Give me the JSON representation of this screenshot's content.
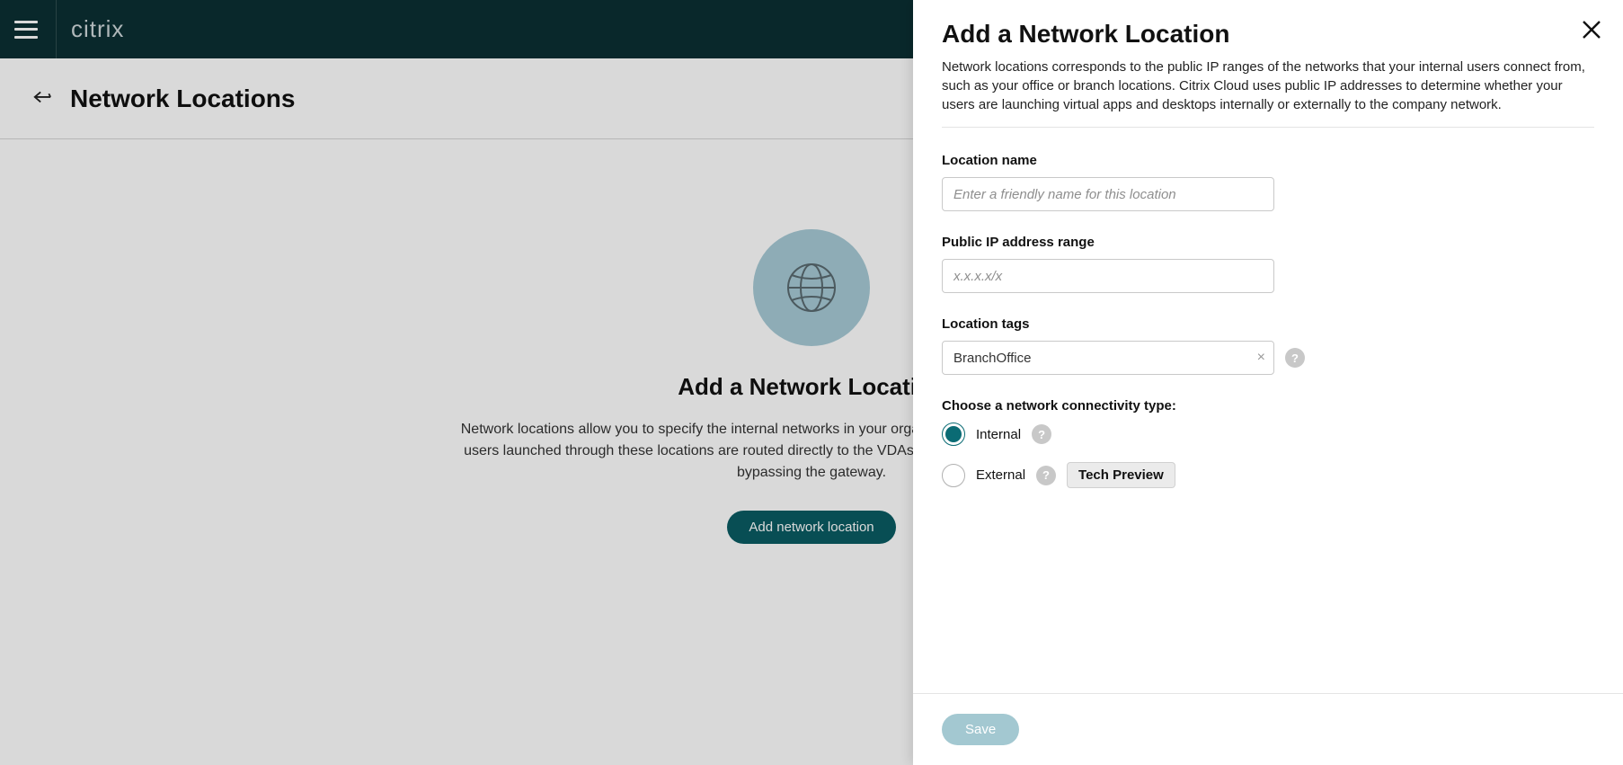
{
  "brand": "citrix",
  "page": {
    "title": "Network Locations"
  },
  "empty": {
    "heading": "Add a Network Location",
    "description": "Network locations allow you to specify the internal networks in your organization. Workspace connections from users launched through these locations are routed directly to the VDAs hosting the virtual apps and desktops, bypassing the gateway.",
    "add_button": "Add network location"
  },
  "panel": {
    "title": "Add a Network Location",
    "description": "Network locations corresponds to the public IP ranges of the networks that your internal users connect from, such as your office or branch locations. Citrix Cloud uses public IP addresses to determine whether your users are launching virtual apps and desktops internally or externally to the company network.",
    "location_name_label": "Location name",
    "location_name_placeholder": "Enter a friendly name for this location",
    "ip_range_label": "Public IP address range",
    "ip_range_placeholder": "x.x.x.x/x",
    "tags_label": "Location tags",
    "tags_value": "BranchOffice",
    "connectivity_label": "Choose a network connectivity type:",
    "radio_internal": "Internal",
    "radio_external": "External",
    "tech_preview": "Tech Preview",
    "save_label": "Save"
  }
}
